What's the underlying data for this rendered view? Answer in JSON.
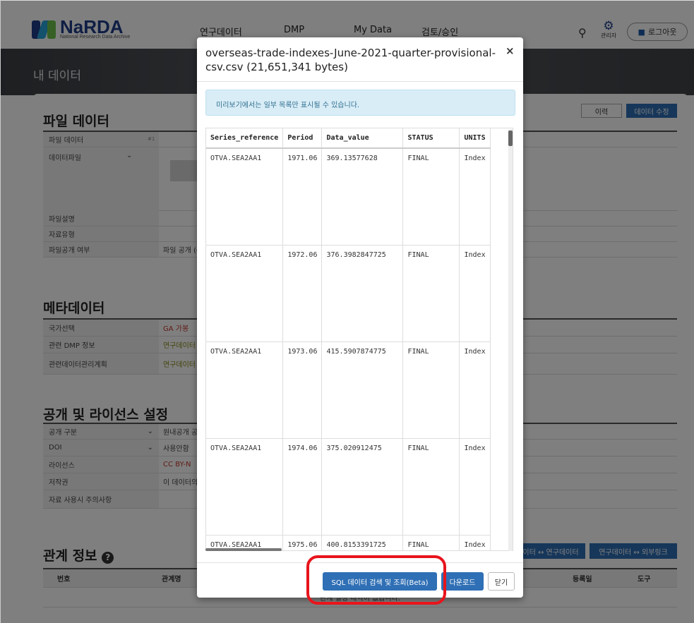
{
  "header": {
    "logo_name": "NaRDA",
    "logo_sub": "National Research Data Archive",
    "nav": [
      "연구데이터",
      "DMP",
      "My Data",
      "검토/승인"
    ],
    "admin_label": "관리자",
    "logout_label": "로그아웃"
  },
  "banner": {
    "title": "내 데이터"
  },
  "file_section": {
    "title": "파일 데이터",
    "history_button": "이력",
    "edit_button": "데이터 수정",
    "rows": [
      {
        "label": "파일 데이터",
        "value": ""
      },
      {
        "label": "데이터파일",
        "value": ""
      },
      {
        "label": "파일설명",
        "value": ""
      },
      {
        "label": "자료유형",
        "value": ""
      },
      {
        "label": "파일공개 여부",
        "value": "파일 공개 (C"
      }
    ],
    "index_tag": "#1"
  },
  "meta_section": {
    "title": "메타데이터",
    "rows": [
      {
        "label": "국가선택",
        "value": "GA 가봉"
      },
      {
        "label": "관련 DMP 정보",
        "value": "연구데이터"
      },
      {
        "label": "관련데이터관리계획",
        "value": "연구데이터"
      }
    ]
  },
  "license_section": {
    "title": "공개 및 라이선스 설정",
    "rows": [
      {
        "label": "공개 구분",
        "value": "원내공개 공"
      },
      {
        "label": "DOI",
        "value": "사용안함"
      },
      {
        "label": "라이선스",
        "value": "CC BY-N"
      },
      {
        "label": "저작권",
        "value": "이 데이터의"
      },
      {
        "label": "자료 사용시 주의사항",
        "value": ""
      }
    ]
  },
  "relation_section": {
    "title": "관계 정보",
    "btn_a": "이터 ↔ 연구데이터",
    "btn_b": "연구데이터 ↔ 외부링크",
    "cols": [
      "번호",
      "관계명",
      "등록일",
      "도구"
    ],
    "empty": "관계 설정 내역이 없습니다."
  },
  "modal": {
    "title": "overseas-trade-indexes-June-2021-quarter-provisional-csv.csv (21,651,341 bytes)",
    "close": "×",
    "alert": "미리보기에서는 일부 목록만 표시될 수 있습니다.",
    "columns": [
      "Series_reference",
      "Period",
      "Data_value",
      "STATUS",
      "UNITS"
    ],
    "rows": [
      [
        "OTVA.SEA2AA1",
        "1971.06",
        "369.13577628",
        "FINAL",
        "Index"
      ],
      [
        "OTVA.SEA2AA1",
        "1972.06",
        "376.3982847725",
        "FINAL",
        "Index"
      ],
      [
        "OTVA.SEA2AA1",
        "1973.06",
        "415.5907874775",
        "FINAL",
        "Index"
      ],
      [
        "OTVA.SEA2AA1",
        "1974.06",
        "375.020912475",
        "FINAL",
        "Index"
      ],
      [
        "OTVA.SEA2AA1",
        "1975.06",
        "400.8153391725",
        "FINAL",
        "Index"
      ]
    ],
    "sql_button": "SQL 데이터 검색 및 조회(Beta)",
    "download_button": "다운로드",
    "close_button": "닫기"
  }
}
